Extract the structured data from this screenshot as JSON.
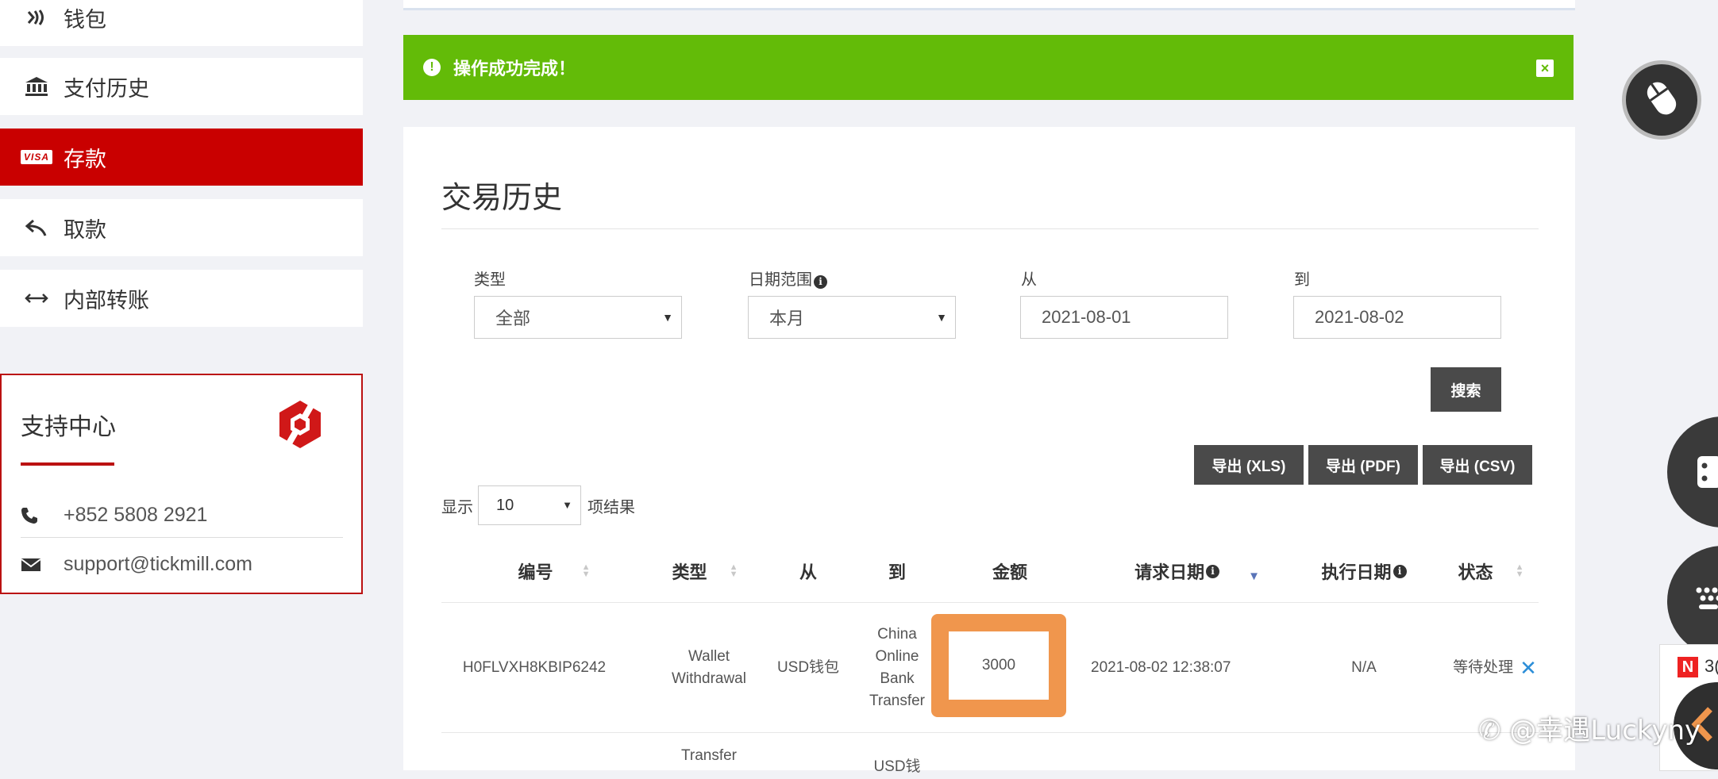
{
  "sidebar": {
    "items": [
      {
        "label": "钱包",
        "icon": "wallet-icon",
        "active": false
      },
      {
        "label": "支付历史",
        "icon": "bank-icon",
        "active": false
      },
      {
        "label": "存款",
        "icon": "visa-card-icon",
        "badge": "VISA",
        "active": true
      },
      {
        "label": "取款",
        "icon": "reply-arrow-icon",
        "active": false
      },
      {
        "label": "内部转账",
        "icon": "transfer-arrows-icon",
        "active": false
      }
    ],
    "support": {
      "title": "支持中心",
      "phone": "+852 5808 2921",
      "email": "support@tickmill.com"
    }
  },
  "alert": {
    "message": "操作成功完成！",
    "color": "#63bb08"
  },
  "main": {
    "title": "交易历史",
    "filters": {
      "type_label": "类型",
      "type_value": "全部",
      "range_label": "日期范围",
      "range_value": "本月",
      "from_label": "从",
      "from_value": "2021-08-01",
      "to_label": "到",
      "to_value": "2021-08-02"
    },
    "search_button": "搜索",
    "export_buttons": [
      "导出 (XLS)",
      "导出 (PDF)",
      "导出 (CSV)"
    ],
    "show_prefix": "显示",
    "show_value": "10",
    "show_suffix": "项结果",
    "table": {
      "columns": [
        "编号",
        "类型",
        "从",
        "到",
        "金额",
        "请求日期",
        "执行日期",
        "状态"
      ],
      "rows": [
        {
          "id": "H0FLVXH8KBIP6242",
          "type_lines": [
            "Wallet",
            "Withdrawal"
          ],
          "from": "USD钱包",
          "to_lines": [
            "China",
            "Online",
            "Bank",
            "Transfer"
          ],
          "amount": "3000",
          "request_date": "2021-08-02 12:38:07",
          "exec_date": "N/A",
          "status": "等待处理"
        }
      ],
      "partial_row": {
        "type_partial": "Transfer",
        "to_partial": "USD钱"
      }
    }
  },
  "overlay": {
    "watermark": "@幸遇Luckyny",
    "thumb_badge": "N",
    "thumb_text": "3("
  },
  "colors": {
    "brand_red": "#c90000",
    "success_green": "#63bb08",
    "highlight_orange": "#f0964d",
    "status_blue": "#2c8ed8"
  }
}
